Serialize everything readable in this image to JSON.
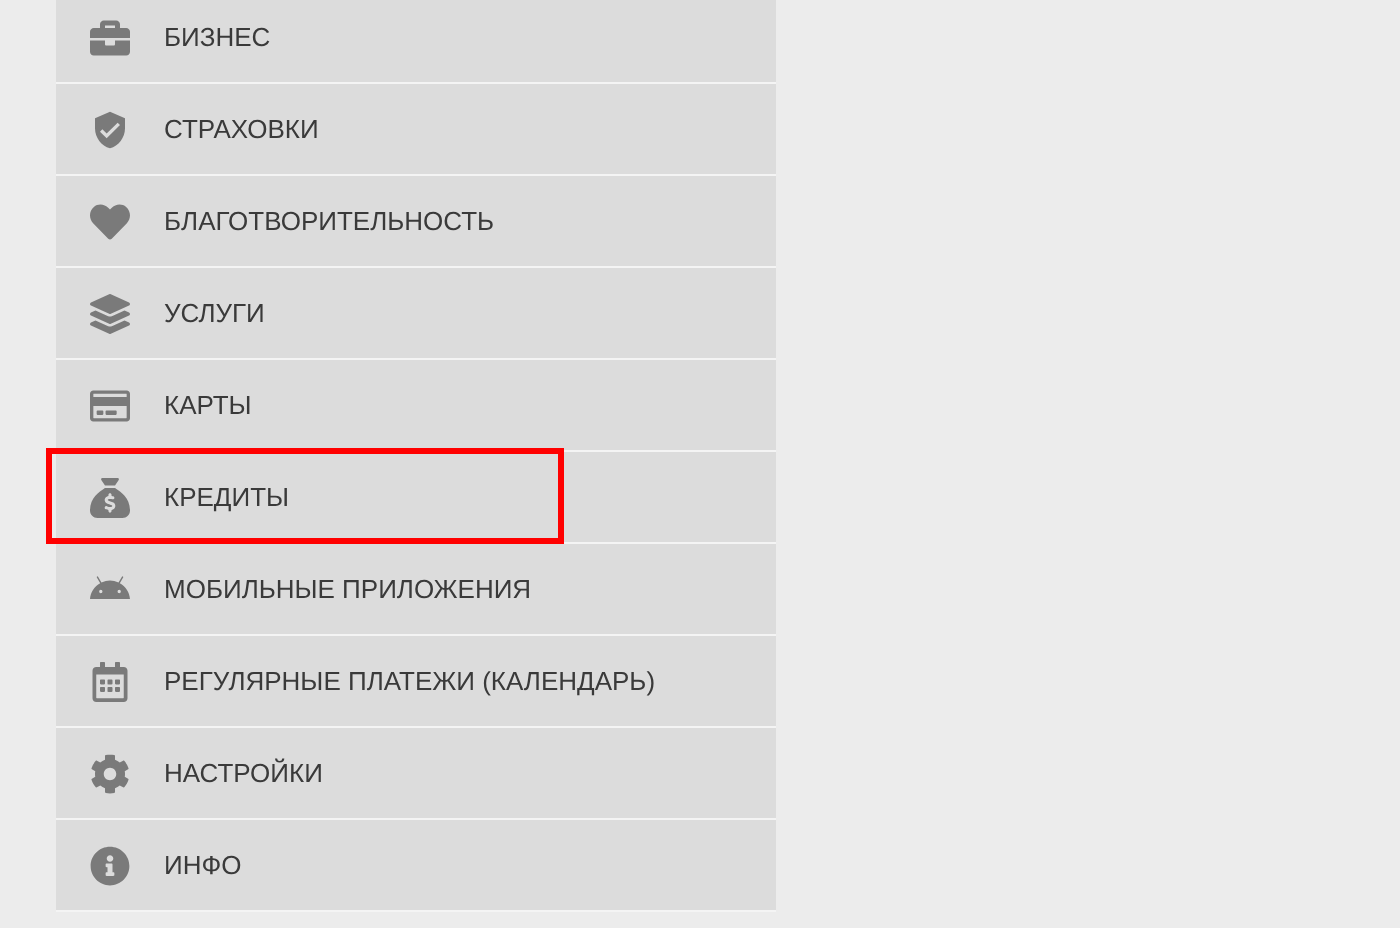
{
  "menu": {
    "items": [
      {
        "kind": "briefcase",
        "label": "БИЗНЕС",
        "highlighted": false
      },
      {
        "kind": "shield",
        "label": "СТРАХОВКИ",
        "highlighted": false
      },
      {
        "kind": "hearts",
        "label": "БЛАГОТВОРИТЕЛЬНОСТЬ",
        "highlighted": false
      },
      {
        "kind": "layers",
        "label": "УСЛУГИ",
        "highlighted": false
      },
      {
        "kind": "card",
        "label": "КАРТЫ",
        "highlighted": false
      },
      {
        "kind": "moneybag",
        "label": "КРЕДИТЫ",
        "highlighted": true
      },
      {
        "kind": "mobile",
        "label": "МОБИЛЬНЫЕ ПРИЛОЖЕНИЯ",
        "highlighted": false
      },
      {
        "kind": "calendar",
        "label": "РЕГУЛЯРНЫЕ ПЛАТЕЖИ (КАЛЕНДАРЬ)",
        "highlighted": false
      },
      {
        "kind": "gear",
        "label": "НАСТРОЙКИ",
        "highlighted": false
      },
      {
        "kind": "info",
        "label": "ИНФО",
        "highlighted": false
      }
    ]
  }
}
